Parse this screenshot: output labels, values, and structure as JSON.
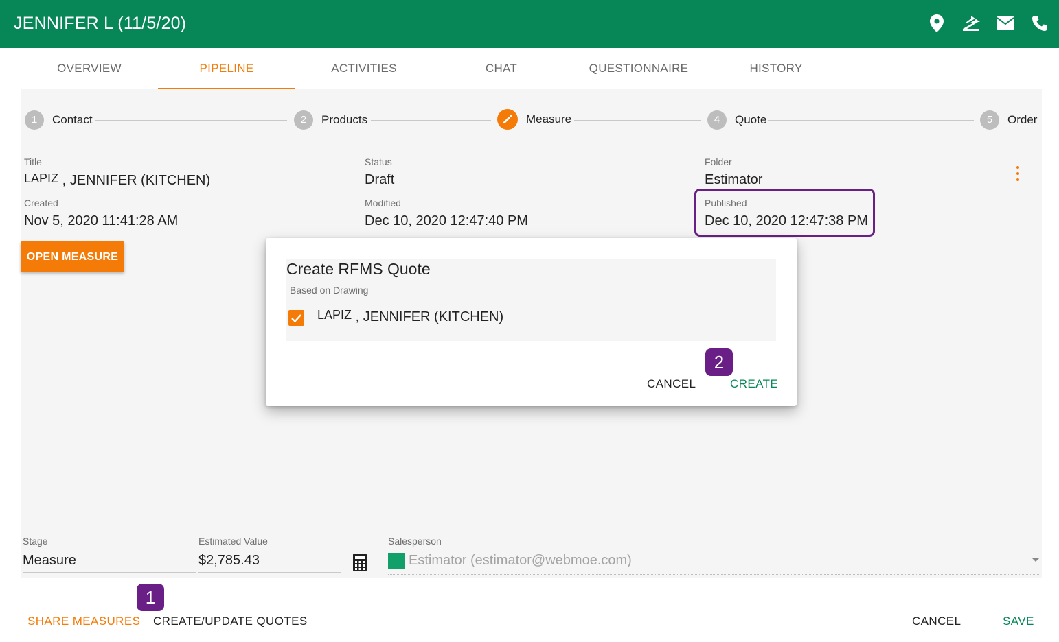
{
  "header": {
    "title": "JENNIFER L (11/5/20)",
    "icons": [
      "location-pin-icon",
      "zillow-icon",
      "mail-icon",
      "phone-icon"
    ],
    "color": "#078657"
  },
  "tabs": [
    {
      "label": "OVERVIEW"
    },
    {
      "label": "PIPELINE",
      "active": true
    },
    {
      "label": "ACTIVITIES"
    },
    {
      "label": "CHAT"
    },
    {
      "label": "QUESTIONNAIRE"
    },
    {
      "label": "HISTORY"
    }
  ],
  "stepper": [
    {
      "num": "1",
      "label": "Contact"
    },
    {
      "num": "2",
      "label": "Products"
    },
    {
      "num": "",
      "label": "Measure",
      "active": true,
      "icon": "pencil-icon"
    },
    {
      "num": "4",
      "label": "Quote"
    },
    {
      "num": "5",
      "label": "Order"
    }
  ],
  "details": {
    "title_label": "Title",
    "title_value_last": "LAPIZ",
    "title_value_rest": ", JENNIFER (KITCHEN)",
    "status_label": "Status",
    "status_value": "Draft",
    "folder_label": "Folder",
    "folder_value": "Estimator",
    "created_label": "Created",
    "created_value": "Nov 5, 2020 11:41:28 AM",
    "modified_label": "Modified",
    "modified_value": "Dec 10, 2020 12:47:40 PM",
    "published_label": "Published",
    "published_value": "Dec 10, 2020 12:47:38 PM"
  },
  "open_measure_label": "OPEN MEASURE",
  "bottom_fields": {
    "stage_label": "Stage",
    "stage_value": "Measure",
    "estimated_label": "Estimated Value",
    "estimated_value": "$2,785.43",
    "salesperson_label": "Salesperson",
    "salesperson_value": "Estimator (estimator@webmoe.com)",
    "salesperson_color": "#12a06a"
  },
  "footer": {
    "share_label": "SHARE MEASURES",
    "create_update_label": "CREATE/UPDATE QUOTES",
    "cancel_label": "CANCEL",
    "save_label": "SAVE"
  },
  "badges": {
    "one": "1",
    "two": "2"
  },
  "dialog": {
    "title": "Create RFMS Quote",
    "subtitle": "Based on Drawing",
    "item_last": "LAPIZ",
    "item_rest": ", JENNIFER (KITCHEN)",
    "checked": true,
    "cancel_label": "CANCEL",
    "create_label": "CREATE"
  },
  "colors": {
    "accent": "#f47b07",
    "primary": "#078657",
    "highlight": "#6a1f86"
  }
}
